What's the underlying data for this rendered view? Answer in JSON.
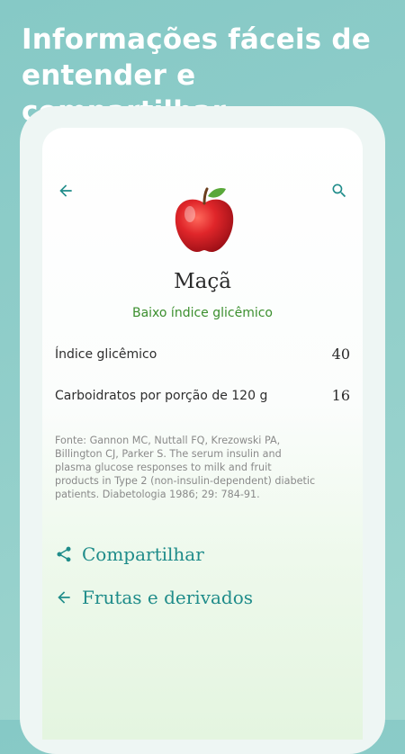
{
  "promo": {
    "headline": "Informações fáceis de entender e compartilhar"
  },
  "colors": {
    "accent": "#1f8c8a",
    "gi_low": "#3b8f2e",
    "background": "#8fcdc9"
  },
  "header": {
    "back_icon": "arrow-back-icon",
    "search_icon": "search-icon"
  },
  "food": {
    "name": "Maçã",
    "image_icon": "apple-icon",
    "gi_category": "Baixo índice glicêmico"
  },
  "details": {
    "rows": [
      {
        "label": "Índice glicêmico",
        "value": "40"
      },
      {
        "label": "Carboidratos por porção de 120 g",
        "value": "16"
      }
    ]
  },
  "source": {
    "text": "Fonte: Gannon MC, Nuttall FQ, Krezowski PA, Billington CJ, Parker S. The serum insulin and plasma glucose responses to milk and fruit products in Type 2 (non-insulin-dependent) diabetic patients. Diabetologia 1986; 29: 784-91."
  },
  "actions": {
    "share_label": "Compartilhar",
    "share_icon": "share-icon",
    "category_label": "Frutas e derivados",
    "category_icon": "arrow-back-icon"
  }
}
